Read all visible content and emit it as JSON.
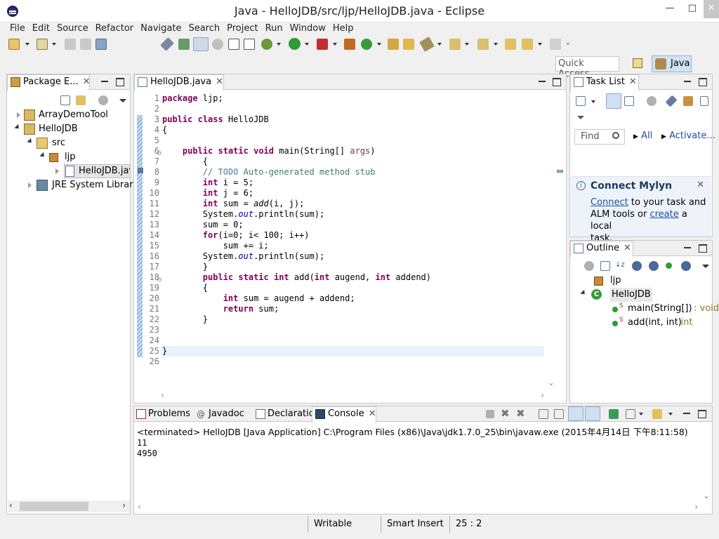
{
  "window": {
    "title": "Java - HelloJDB/src/ljp/HelloJDB.java - Eclipse"
  },
  "menu": [
    "File",
    "Edit",
    "Source",
    "Refactor",
    "Navigate",
    "Search",
    "Project",
    "Run",
    "Window",
    "Help"
  ],
  "toolbar": {
    "quick_access_placeholder": "Quick Access",
    "perspective": "Java"
  },
  "package_explorer": {
    "tab": "Package E...",
    "items": [
      "ArrayDemoTool",
      "HelloJDB",
      "src",
      "ljp",
      "HelloJDB.jav",
      "JRE System Library"
    ]
  },
  "editor": {
    "tab": "HelloJDB.java",
    "line_numbers": [
      "1",
      "2",
      "3",
      "4",
      "5",
      "6",
      "7",
      "8",
      "9",
      "10",
      "11",
      "12",
      "13",
      "14",
      "15",
      "16",
      "17",
      "18",
      "19",
      "20",
      "21",
      "22",
      "23",
      "24",
      "25",
      "26"
    ]
  },
  "task_list": {
    "tab": "Task List",
    "find_placeholder": "Find",
    "all": "All",
    "activate": "Activate...",
    "mylyn_title": "Connect Mylyn",
    "mylyn_connect": "Connect",
    "mylyn_text1": " to your task and",
    "mylyn_text2": "ALM tools or ",
    "mylyn_create": "create",
    "mylyn_text3": " a local",
    "mylyn_text4": "task."
  },
  "outline": {
    "tab": "Outline",
    "package": "ljp",
    "class": "HelloJDB",
    "methods": [
      {
        "name": "main(String[])",
        "type": " : void"
      },
      {
        "name": "add(int, int)",
        "type": " : int"
      }
    ]
  },
  "bottom_tabs": {
    "problems": "Problems",
    "javadoc": "Javadoc",
    "declaration": "Declaration",
    "console": "Console"
  },
  "console": {
    "header": "<terminated> HelloJDB [Java Application] C:\\Program Files (x86)\\Java\\jdk1.7.0_25\\bin\\javaw.exe (2015年4月14日 下午8:11:58)",
    "output": [
      "11",
      "4950"
    ]
  },
  "status": {
    "writable": "Writable",
    "insert_mode": "Smart Insert",
    "position": "25 : 2"
  }
}
